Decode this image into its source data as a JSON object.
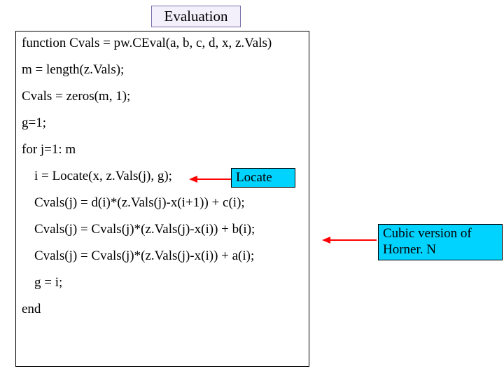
{
  "title": "Evaluation",
  "code": {
    "l1": "function Cvals = pw.CEval(a, b, c, d, x, z.Vals)",
    "l2": "m = length(z.Vals);",
    "l3": "Cvals = zeros(m, 1);",
    "l4": "g=1;",
    "l5": "for j=1: m",
    "l6": "i = Locate(x, z.Vals(j), g);",
    "l7": "Cvals(j) = d(i)*(z.Vals(j)-x(i+1)) + c(i);",
    "l8": "Cvals(j) = Cvals(j)*(z.Vals(j)-x(i)) + b(i);",
    "l9": "Cvals(j) = Cvals(j)*(z.Vals(j)-x(i)) + a(i);",
    "l10": "g = i;",
    "l11": "end"
  },
  "callouts": {
    "locate": "Locate",
    "horner": "Cubic version of Horner. N"
  },
  "colors": {
    "title_border": "#7a6faa",
    "title_bg": "#f3f0fb",
    "callout_bg": "#00d3ff",
    "arrow": "#ff0000"
  }
}
